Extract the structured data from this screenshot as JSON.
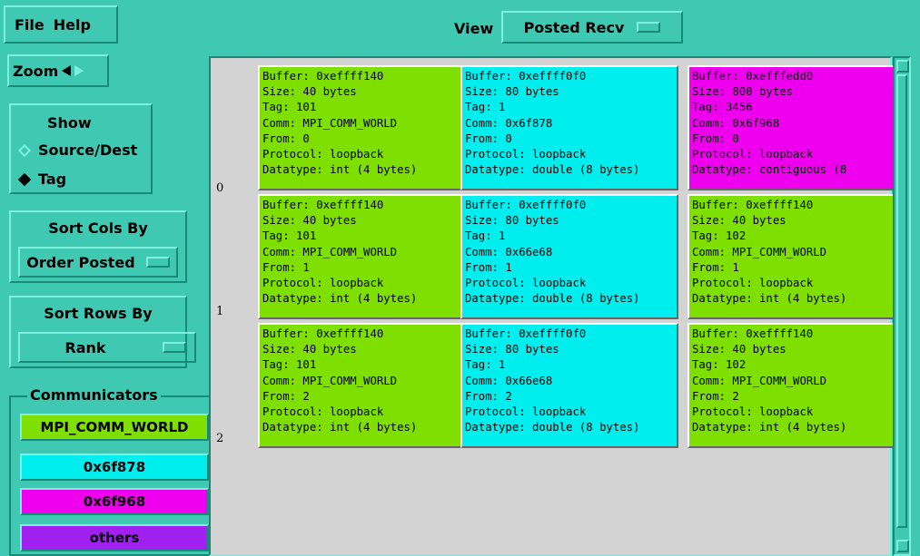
{
  "menu": {
    "file": "File",
    "help": "Help"
  },
  "view": {
    "label": "View",
    "selected": "Posted Recv"
  },
  "zoom": {
    "label": "Zoom"
  },
  "show": {
    "title": "Show",
    "options": [
      "Source/Dest",
      "Tag"
    ],
    "selected": "Tag"
  },
  "sort_cols": {
    "title": "Sort Cols By",
    "selected": "Order Posted"
  },
  "sort_rows": {
    "title": "Sort Rows By",
    "selected": "Rank"
  },
  "communicators": {
    "title": "Communicators",
    "items": [
      {
        "label": "MPI_COMM_WORLD",
        "color": "#7fe000"
      },
      {
        "label": "0x6f878",
        "color": "#00eeee"
      },
      {
        "label": "0x6f968",
        "color": "#ee00ee"
      },
      {
        "label": "others",
        "color": "#a020f0"
      }
    ]
  },
  "row_labels": [
    "0",
    "1",
    "2"
  ],
  "cells": [
    [
      {
        "color": "#7fe000",
        "lines": [
          "Buffer: 0xeffff140",
          "Size: 40 bytes",
          "Tag: 101",
          "Comm: MPI_COMM_WORLD",
          "From: 0",
          "Protocol: loopback",
          "Datatype: int (4 bytes)"
        ]
      },
      {
        "color": "#00eeee",
        "lines": [
          "Buffer: 0xeffff0f0",
          "Size: 80 bytes",
          "Tag: 1",
          "Comm: 0x6f878",
          "From: 0",
          "Protocol: loopback",
          "Datatype: double (8 bytes)"
        ]
      },
      {
        "color": "#ee00ee",
        "lines": [
          "Buffer: 0xefffedd0",
          "Size: 800 bytes",
          "Tag: 3456",
          "Comm: 0x6f968",
          "From: 0",
          "Protocol: loopback",
          "Datatype: contiguous (8"
        ]
      }
    ],
    [
      {
        "color": "#7fe000",
        "lines": [
          "Buffer: 0xeffff140",
          "Size: 40 bytes",
          "Tag: 101",
          "Comm: MPI_COMM_WORLD",
          "From: 1",
          "Protocol: loopback",
          "Datatype: int (4 bytes)"
        ]
      },
      {
        "color": "#00eeee",
        "lines": [
          "Buffer: 0xeffff0f0",
          "Size: 80 bytes",
          "Tag: 1",
          "Comm: 0x66e68",
          "From: 1",
          "Protocol: loopback",
          "Datatype: double (8 bytes)"
        ]
      },
      {
        "color": "#7fe000",
        "lines": [
          "Buffer: 0xeffff140",
          "Size: 40 bytes",
          "Tag: 102",
          "Comm: MPI_COMM_WORLD",
          "From: 1",
          "Protocol: loopback",
          "Datatype: int (4 bytes)"
        ]
      }
    ],
    [
      {
        "color": "#7fe000",
        "lines": [
          "Buffer: 0xeffff140",
          "Size: 40 bytes",
          "Tag: 101",
          "Comm: MPI_COMM_WORLD",
          "From: 2",
          "Protocol: loopback",
          "Datatype: int (4 bytes)"
        ]
      },
      {
        "color": "#00eeee",
        "lines": [
          "Buffer: 0xeffff0f0",
          "Size: 80 bytes",
          "Tag: 1",
          "Comm: 0x66e68",
          "From: 2",
          "Protocol: loopback",
          "Datatype: double (8 bytes)"
        ]
      },
      {
        "color": "#7fe000",
        "lines": [
          "Buffer: 0xeffff140",
          "Size: 40 bytes",
          "Tag: 102",
          "Comm: MPI_COMM_WORLD",
          "From: 2",
          "Protocol: loopback",
          "Datatype: int (4 bytes)"
        ]
      }
    ]
  ]
}
